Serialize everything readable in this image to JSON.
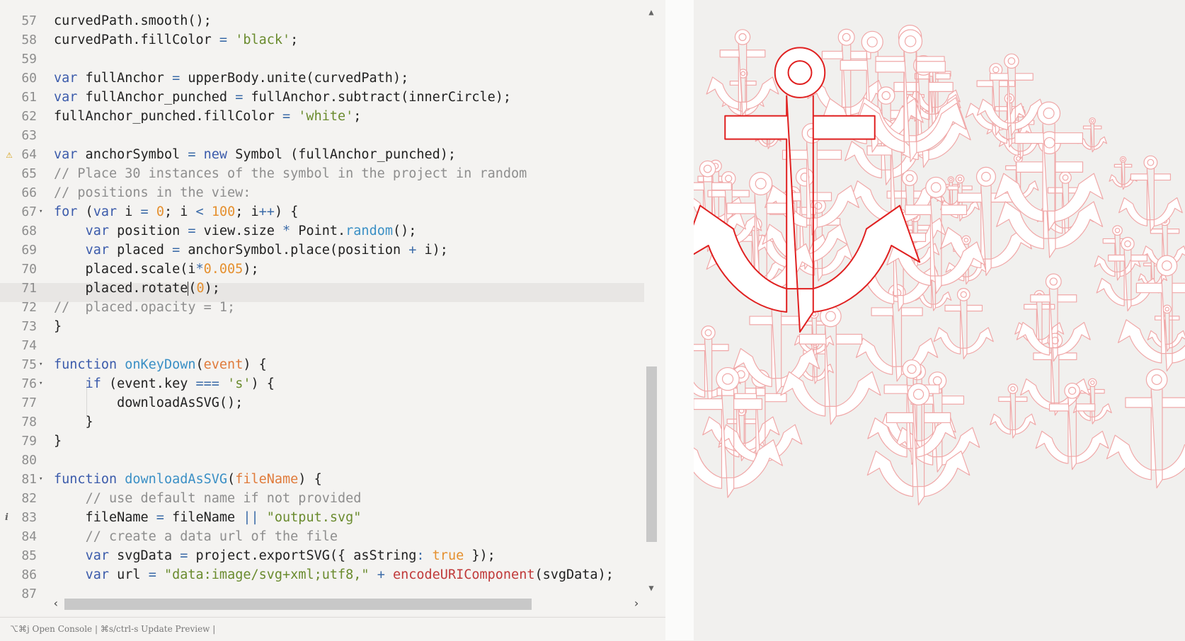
{
  "editor": {
    "active_line": 71,
    "line_numbers": [
      "57",
      "58",
      "59",
      "60",
      "61",
      "62",
      "63",
      "64",
      "65",
      "66",
      "67",
      "68",
      "69",
      "70",
      "71",
      "72",
      "73",
      "74",
      "75",
      "76",
      "77",
      "78",
      "79",
      "80",
      "81",
      "82",
      "83",
      "84",
      "85",
      "86",
      "87"
    ],
    "lines": [
      [
        [
          "curvedPath.smooth();",
          ""
        ]
      ],
      [
        [
          "curvedPath.fillColor ",
          ""
        ],
        [
          "=",
          "op"
        ],
        [
          " ",
          ""
        ],
        [
          "'black'",
          "str"
        ],
        [
          ";",
          ""
        ]
      ],
      [],
      [
        [
          "var",
          "kw"
        ],
        [
          " fullAnchor ",
          ""
        ],
        [
          "=",
          "op"
        ],
        [
          " upperBody.unite(curvedPath);",
          ""
        ]
      ],
      [
        [
          "var",
          "kw"
        ],
        [
          " fullAnchor_punched ",
          ""
        ],
        [
          "=",
          "op"
        ],
        [
          " fullAnchor.subtract(innerCircle);",
          ""
        ]
      ],
      [
        [
          "fullAnchor_punched.fillColor ",
          ""
        ],
        [
          "=",
          "op"
        ],
        [
          " ",
          ""
        ],
        [
          "'white'",
          "str"
        ],
        [
          ";",
          ""
        ]
      ],
      [],
      [
        [
          "var",
          "kw"
        ],
        [
          " anchorSymbol ",
          ""
        ],
        [
          "=",
          "op"
        ],
        [
          " ",
          ""
        ],
        [
          "new",
          "kw"
        ],
        [
          " Symbol (fullAnchor_punched);",
          ""
        ]
      ],
      [
        [
          "// Place 30 instances of the symbol in the project in random",
          "cm"
        ]
      ],
      [
        [
          "// positions in the view:",
          "cm"
        ]
      ],
      [
        [
          "for",
          "kw"
        ],
        [
          " (",
          ""
        ],
        [
          "var",
          "kw"
        ],
        [
          " i ",
          ""
        ],
        [
          "=",
          "op"
        ],
        [
          " ",
          ""
        ],
        [
          "0",
          "num"
        ],
        [
          "; i ",
          ""
        ],
        [
          "<",
          "op"
        ],
        [
          " ",
          ""
        ],
        [
          "100",
          "num"
        ],
        [
          "; i",
          ""
        ],
        [
          "++",
          "op"
        ],
        [
          ") {",
          ""
        ]
      ],
      [
        [
          "    ",
          ""
        ],
        [
          "var",
          "kw"
        ],
        [
          " position ",
          ""
        ],
        [
          "=",
          "op"
        ],
        [
          " view.size ",
          ""
        ],
        [
          "*",
          "op"
        ],
        [
          " Point.",
          ""
        ],
        [
          "random",
          "fn"
        ],
        [
          "();",
          ""
        ]
      ],
      [
        [
          "    ",
          ""
        ],
        [
          "var",
          "kw"
        ],
        [
          " placed ",
          ""
        ],
        [
          "=",
          "op"
        ],
        [
          " anchorSymbol.place(position ",
          ""
        ],
        [
          "+",
          "op"
        ],
        [
          " i);",
          ""
        ]
      ],
      [
        [
          "    placed.scale(i",
          ""
        ],
        [
          "*",
          "op"
        ],
        [
          "0.005",
          "num"
        ],
        [
          ");",
          ""
        ]
      ],
      [
        [
          "    placed.rotate",
          ""
        ],
        [
          "|",
          "cursor"
        ],
        [
          "(",
          ""
        ],
        [
          "0",
          "num"
        ],
        [
          ");",
          ""
        ]
      ],
      [
        [
          "//  placed.opacity = 1;",
          "cm"
        ]
      ],
      [
        [
          "}",
          ""
        ]
      ],
      [],
      [
        [
          "function",
          "kw"
        ],
        [
          " ",
          ""
        ],
        [
          "onKeyDown",
          "fn"
        ],
        [
          "(",
          ""
        ],
        [
          "event",
          "pm"
        ],
        [
          ") {",
          ""
        ]
      ],
      [
        [
          "    ",
          ""
        ],
        [
          "if",
          "kw"
        ],
        [
          " (event.key ",
          ""
        ],
        [
          "===",
          "op"
        ],
        [
          " ",
          ""
        ],
        [
          "'s'",
          "str"
        ],
        [
          ") {",
          ""
        ]
      ],
      [
        [
          "        downloadAsSVG();",
          ""
        ]
      ],
      [
        [
          "    }",
          ""
        ]
      ],
      [
        [
          "}",
          ""
        ]
      ],
      [],
      [
        [
          "function",
          "kw"
        ],
        [
          " ",
          ""
        ],
        [
          "downloadAsSVG",
          "fn"
        ],
        [
          "(",
          ""
        ],
        [
          "fileName",
          "pm"
        ],
        [
          ") {",
          ""
        ]
      ],
      [
        [
          "    ",
          ""
        ],
        [
          "// use default name if not provided",
          "cm"
        ]
      ],
      [
        [
          "    fileName ",
          ""
        ],
        [
          "=",
          "op"
        ],
        [
          " fileName ",
          ""
        ],
        [
          "||",
          "op"
        ],
        [
          " ",
          ""
        ],
        [
          "\"output.svg\"",
          "str"
        ]
      ],
      [
        [
          "    ",
          ""
        ],
        [
          "// create a data url of the file",
          "cm"
        ]
      ],
      [
        [
          "    ",
          ""
        ],
        [
          "var",
          "kw"
        ],
        [
          " svgData ",
          ""
        ],
        [
          "=",
          "op"
        ],
        [
          " project.exportSVG({ asString",
          ""
        ],
        [
          ":",
          "op"
        ],
        [
          " ",
          ""
        ],
        [
          "true",
          "num"
        ],
        [
          " });",
          ""
        ]
      ],
      [
        [
          "    ",
          ""
        ],
        [
          "var",
          "kw"
        ],
        [
          " url ",
          ""
        ],
        [
          "=",
          "op"
        ],
        [
          " ",
          ""
        ],
        [
          "\"data:image/svg+xml;utf8,\"",
          "str"
        ],
        [
          " ",
          ""
        ],
        [
          "+",
          "op"
        ],
        [
          " ",
          ""
        ],
        [
          "encodeURIComponent",
          "bi"
        ],
        [
          "(svgData);",
          ""
        ]
      ],
      []
    ],
    "fold_lines": [
      "67",
      "75",
      "76",
      "81"
    ],
    "warning_line": "64",
    "info_line": "83"
  },
  "status": {
    "text": "⌥⌘j Open Console | ⌘s/ctrl-s Update Preview |"
  },
  "scroll_icons": {
    "up": "chevron-up",
    "down": "chevron-down",
    "left": "chevron-left",
    "right": "chevron-right"
  },
  "preview": {
    "stroke_light": "#f0a8a8",
    "stroke_dark": "#e02020",
    "fill": "#ffffff"
  }
}
